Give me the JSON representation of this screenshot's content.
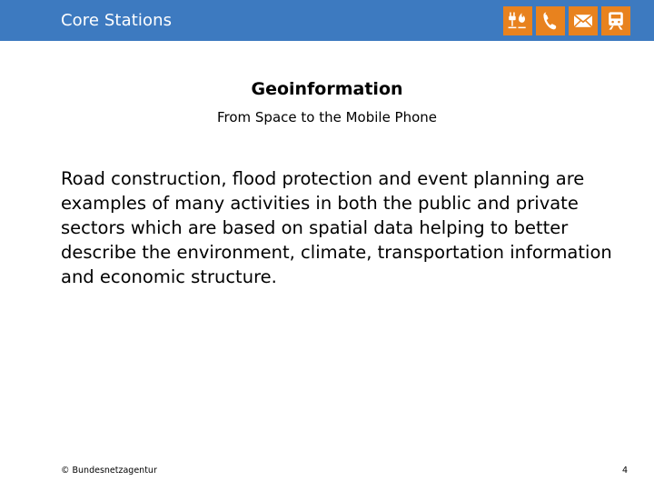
{
  "header": {
    "title": "Core Stations",
    "band_color": "#3d7ac0",
    "icon_color": "#e8821e",
    "icons": [
      {
        "name": "electricity-gas-icon",
        "label": "Electricity and gas"
      },
      {
        "name": "telephone-icon",
        "label": "Telecommunications"
      },
      {
        "name": "mail-envelope-icon",
        "label": "Post"
      },
      {
        "name": "railway-icon",
        "label": "Railway"
      }
    ]
  },
  "main": {
    "title": "Geoinformation",
    "subtitle": "From Space to the Mobile Phone",
    "body": "Road construction, flood protection and event planning are examples of many activities in both the public and private sectors which are based on spatial data helping to better describe the environment, climate, transportation information and economic structure."
  },
  "footer": {
    "copyright": "© Bundesnetzagentur",
    "page_number": "4"
  }
}
